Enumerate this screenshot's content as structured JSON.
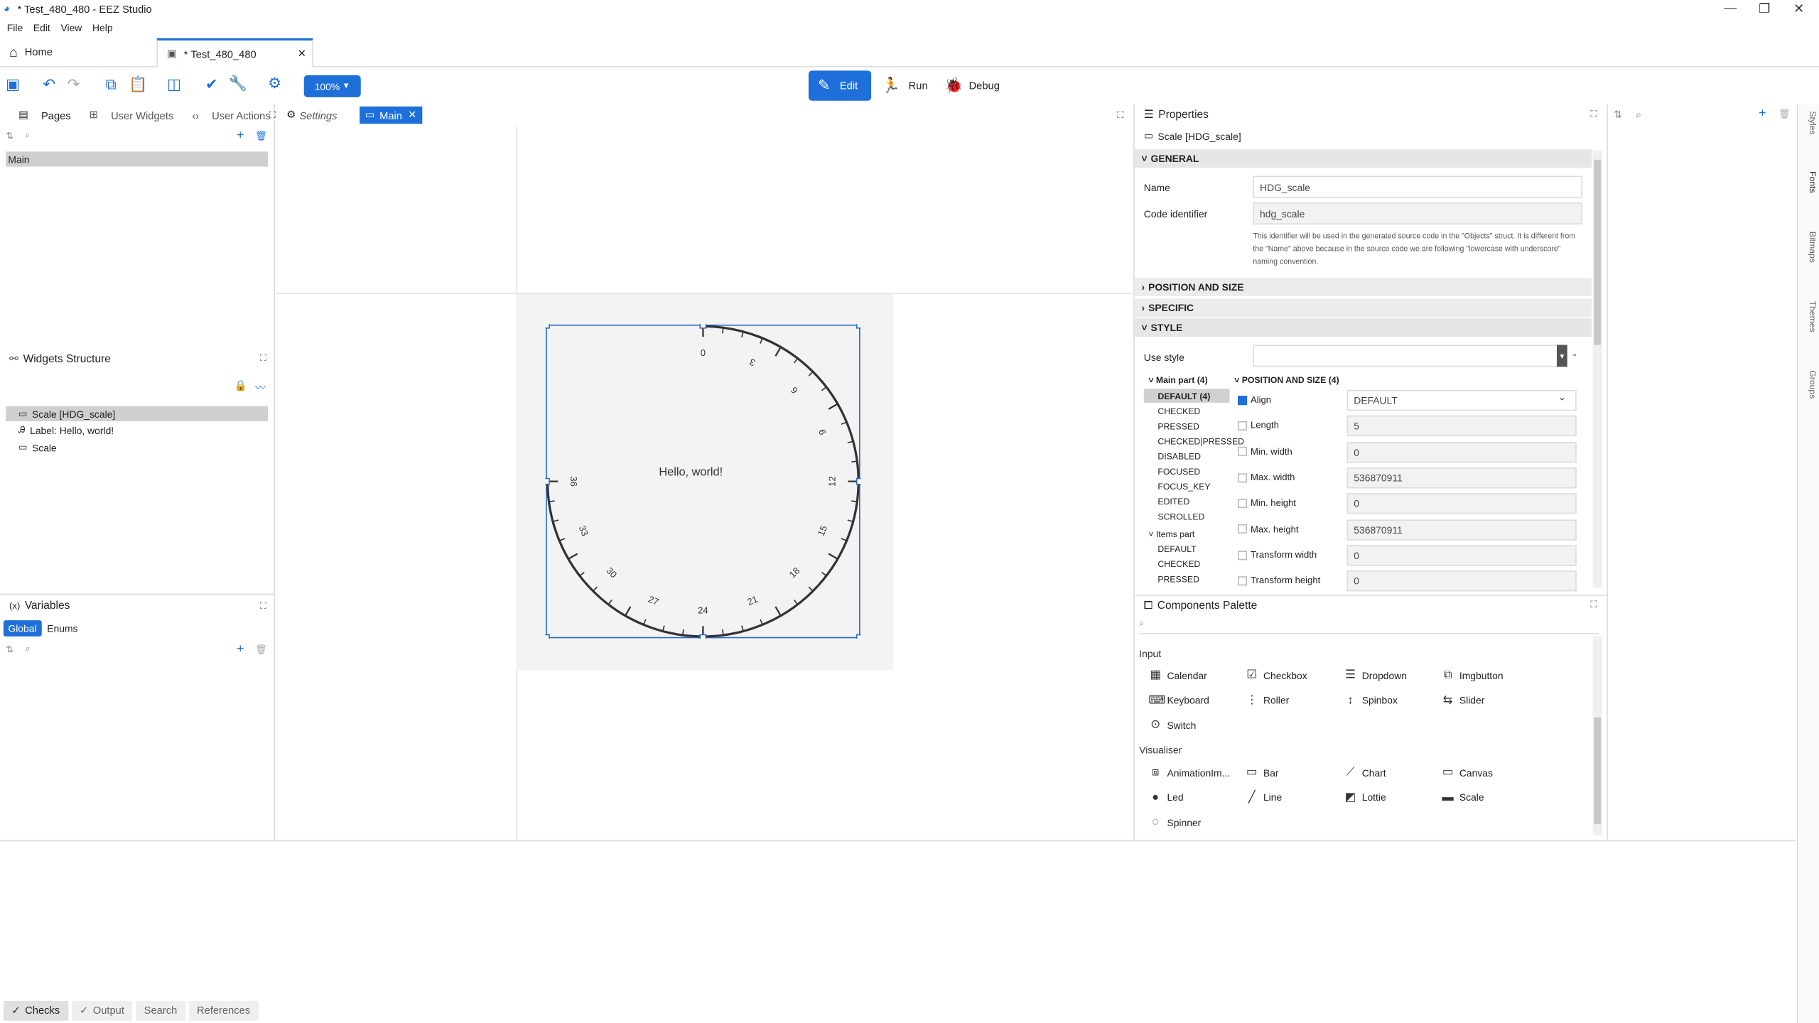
{
  "window": {
    "title": "* Test_480_480 - EEZ Studio"
  },
  "menu": [
    "File",
    "Edit",
    "View",
    "Help"
  ],
  "tabs": {
    "home": "Home",
    "doc": "* Test_480_480"
  },
  "toolbar": {
    "zoom": "100%",
    "edit": "Edit",
    "run": "Run",
    "debug": "Debug"
  },
  "left": {
    "tabs": [
      "Pages",
      "User Widgets",
      "User Actions"
    ],
    "pages": [
      "Main"
    ],
    "structure_title": "Widgets Structure",
    "structure": [
      "Scale [HDG_scale]",
      "Label: Hello, world!",
      "Scale"
    ],
    "variables_title": "Variables",
    "var_tabs": [
      "Global",
      "Enums"
    ]
  },
  "center": {
    "tabs": [
      "Settings",
      "Main"
    ],
    "label_text": "Hello, world!",
    "scale_labels": [
      "0",
      "3",
      "6",
      "9",
      "12",
      "15",
      "18",
      "21",
      "24",
      "27",
      "30",
      "33",
      "36"
    ]
  },
  "properties": {
    "title": "Properties",
    "object": "Scale [HDG_scale]",
    "general": "GENERAL",
    "name_label": "Name",
    "name_value": "HDG_scale",
    "code_label": "Code identifier",
    "code_value": "hdg_scale",
    "code_note": "This identifier will be used in the generated source code in the \"Objects\" struct. It is different from the \"Name\" above because in the source code we are following \"lowercase with underscore\" naming convention.",
    "sections": [
      "POSITION AND SIZE",
      "SPECIFIC",
      "STYLE"
    ],
    "use_style": "Use style",
    "main_part": "Main part (4)",
    "states": [
      "DEFAULT (4)",
      "CHECKED",
      "PRESSED",
      "CHECKED|PRESSED",
      "DISABLED",
      "FOCUSED",
      "FOCUS_KEY",
      "EDITED",
      "SCROLLED"
    ],
    "items_part": "Items part",
    "item_states": [
      "DEFAULT",
      "CHECKED",
      "PRESSED"
    ],
    "pos_title": "POSITION AND SIZE (4)",
    "props": [
      {
        "label": "Align",
        "value": "DEFAULT",
        "checked": true
      },
      {
        "label": "Length",
        "value": "5"
      },
      {
        "label": "Min. width",
        "value": "0"
      },
      {
        "label": "Max. width",
        "value": "536870911"
      },
      {
        "label": "Min. height",
        "value": "0"
      },
      {
        "label": "Max. height",
        "value": "536870911"
      },
      {
        "label": "Transform width",
        "value": "0"
      },
      {
        "label": "Transform height",
        "value": "0"
      }
    ]
  },
  "palette": {
    "title": "Components Palette",
    "input_title": "Input",
    "input": [
      "Calendar",
      "Checkbox",
      "Dropdown",
      "Imgbutton",
      "Keyboard",
      "Roller",
      "Spinbox",
      "Slider",
      "Switch"
    ],
    "vis_title": "Visualiser",
    "vis": [
      "AnimationIm...",
      "Bar",
      "Chart",
      "Canvas",
      "Led",
      "Line",
      "Lottie",
      "Scale",
      "Spinner"
    ]
  },
  "side_tabs": [
    "Styles",
    "Fonts",
    "Bitmaps",
    "Themes",
    "Groups"
  ],
  "status": [
    "Checks",
    "Output",
    "Search",
    "References"
  ],
  "colors": {
    "accent": "#1e6fd9"
  }
}
